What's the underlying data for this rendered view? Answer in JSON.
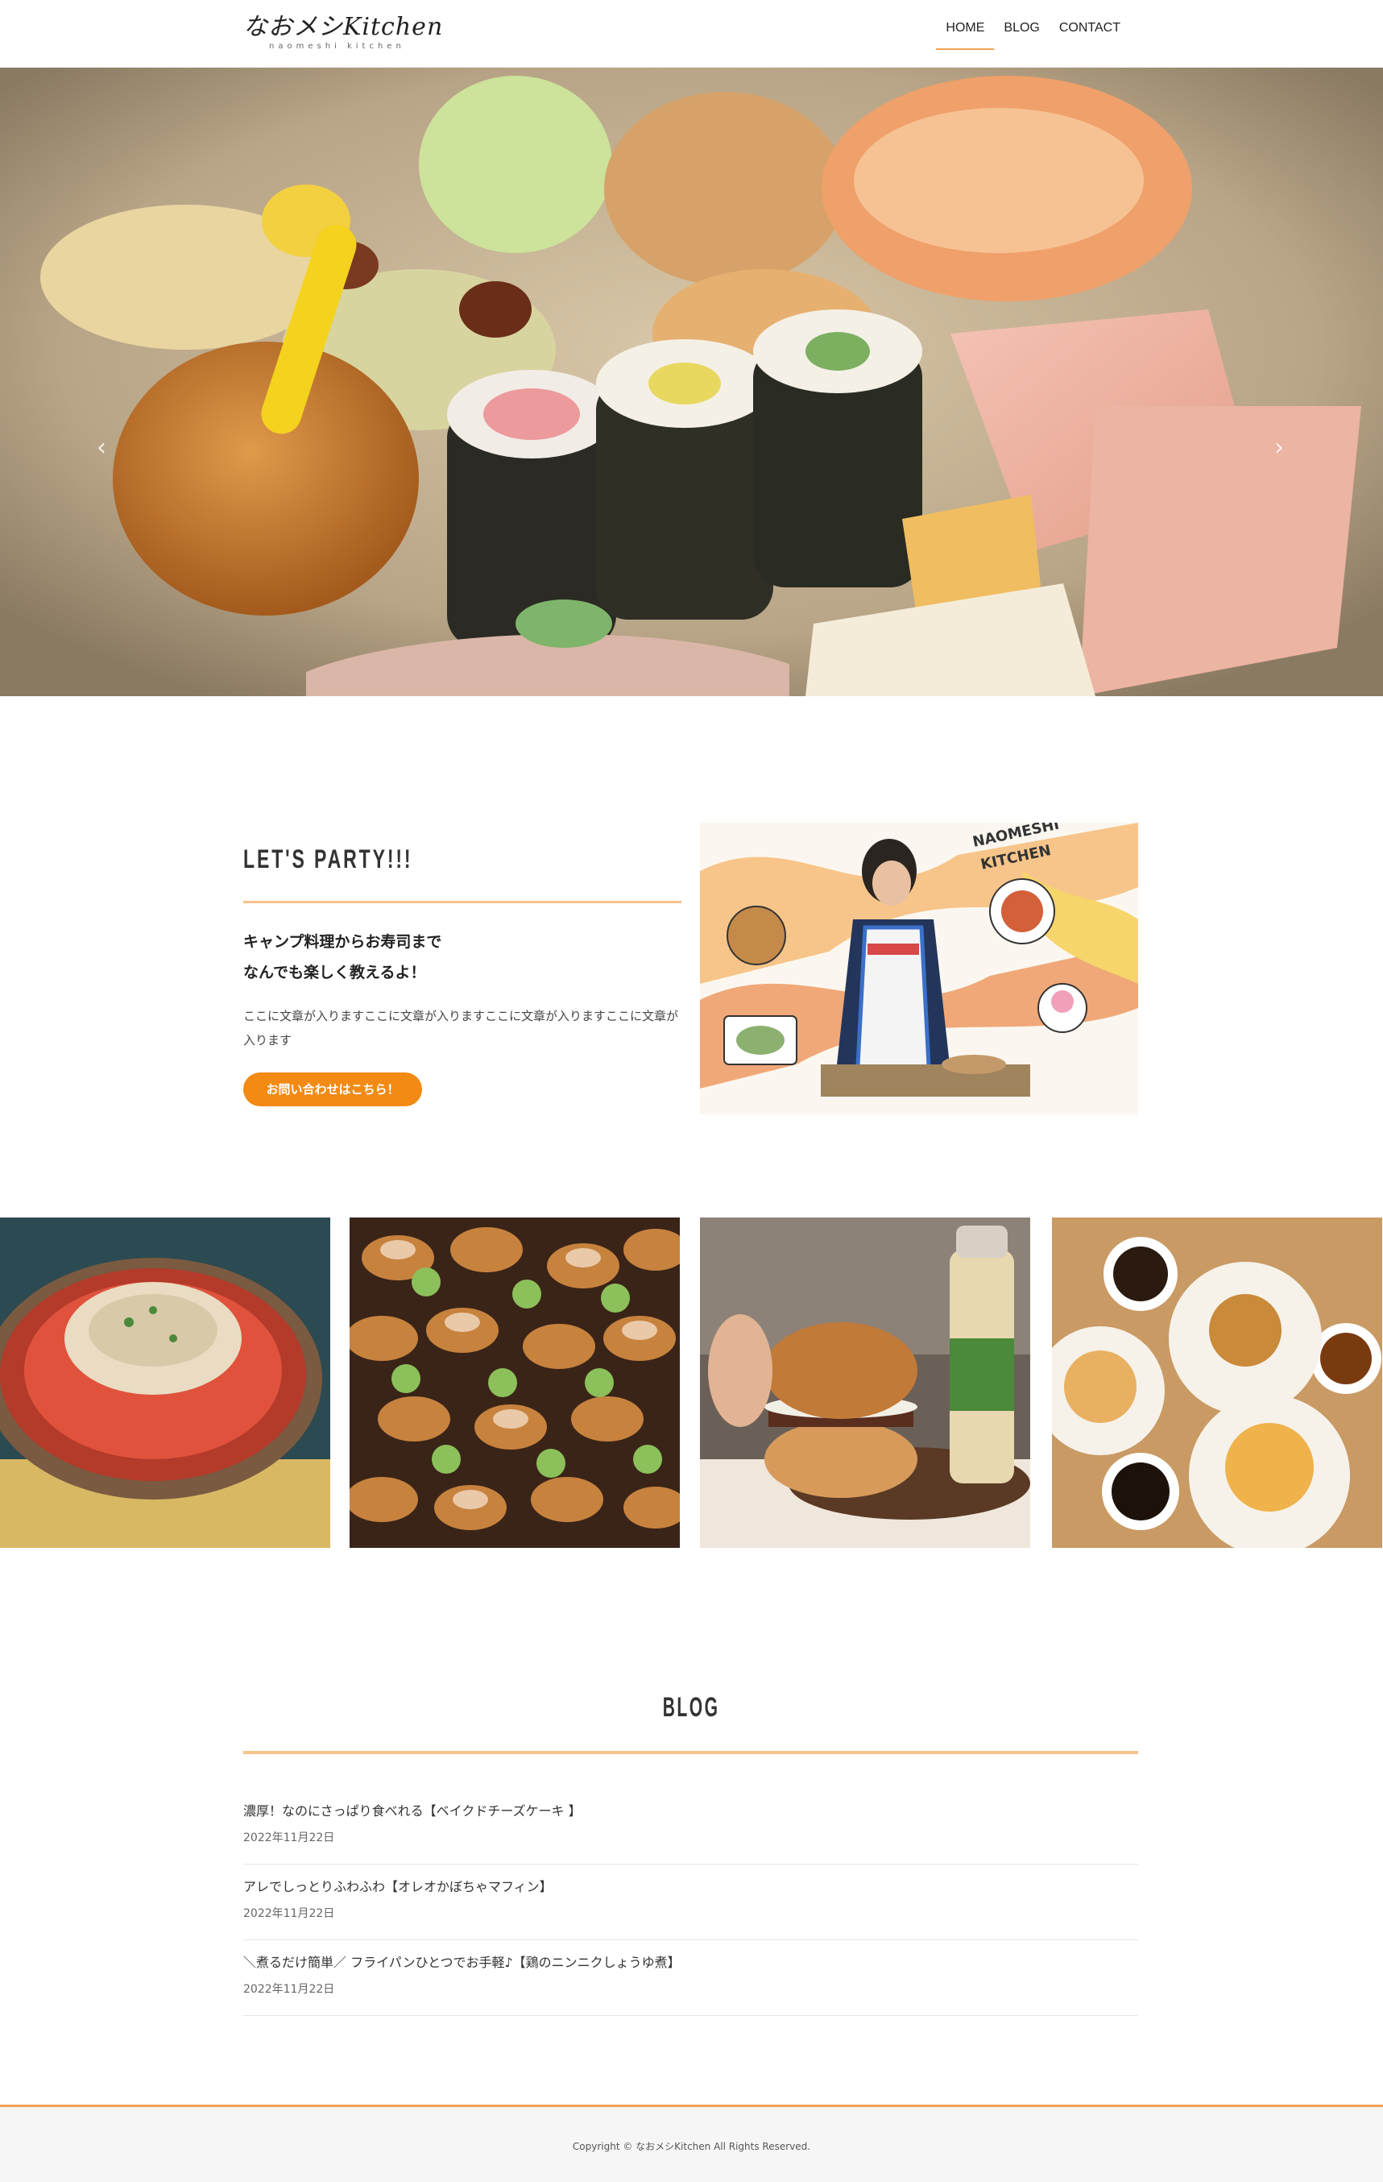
{
  "header": {
    "logo_text": "なおメシKitchen",
    "logo_sub": "naomeshi kitchen",
    "nav": [
      {
        "label": "HOME",
        "active": true
      },
      {
        "label": "BLOG",
        "active": false
      },
      {
        "label": "CONTACT",
        "active": false
      }
    ]
  },
  "hero": {
    "image": "bento-box-photo",
    "prev_icon": "‹",
    "next_icon": "›",
    "slides_count": 3,
    "active_slide": 3
  },
  "party": {
    "title": "LET'S PARTY!!!",
    "lead_line1": "キャンプ料理からお寿司まで",
    "lead_line2": "なんでも楽しく教えるよ！",
    "body": "ここに文章が入りますここに文章が入りますここに文章が入りますここに文章が入ります",
    "cta_label": "お問い合わせはこちら！",
    "illustration": "chef-illustration"
  },
  "gallery": [
    "tomato-salad-photo",
    "canape-platter-photo",
    "burger-with-mustard-photo",
    "muffins-and-coffee-photo"
  ],
  "blog": {
    "title": "BLOG",
    "posts": [
      {
        "title": "濃厚！なのにさっぱり食べれる【ベイクドチーズケーキ 】",
        "date": "2022年11月22日"
      },
      {
        "title": "アレでしっとりふわふわ【オレオかぼちゃマフィン】",
        "date": "2022年11月22日"
      },
      {
        "title": "＼煮るだけ簡単／ フライパンひとつでお手軽♪【鶏のニンニクしょうゆ煮】",
        "date": "2022年11月22日"
      }
    ]
  },
  "footer": {
    "copyright": "Copyright © なおメシKitchen All Rights Reserved."
  },
  "colors": {
    "accent": "#f28a13",
    "accent_light": "#f6c48a",
    "text": "#333333"
  }
}
